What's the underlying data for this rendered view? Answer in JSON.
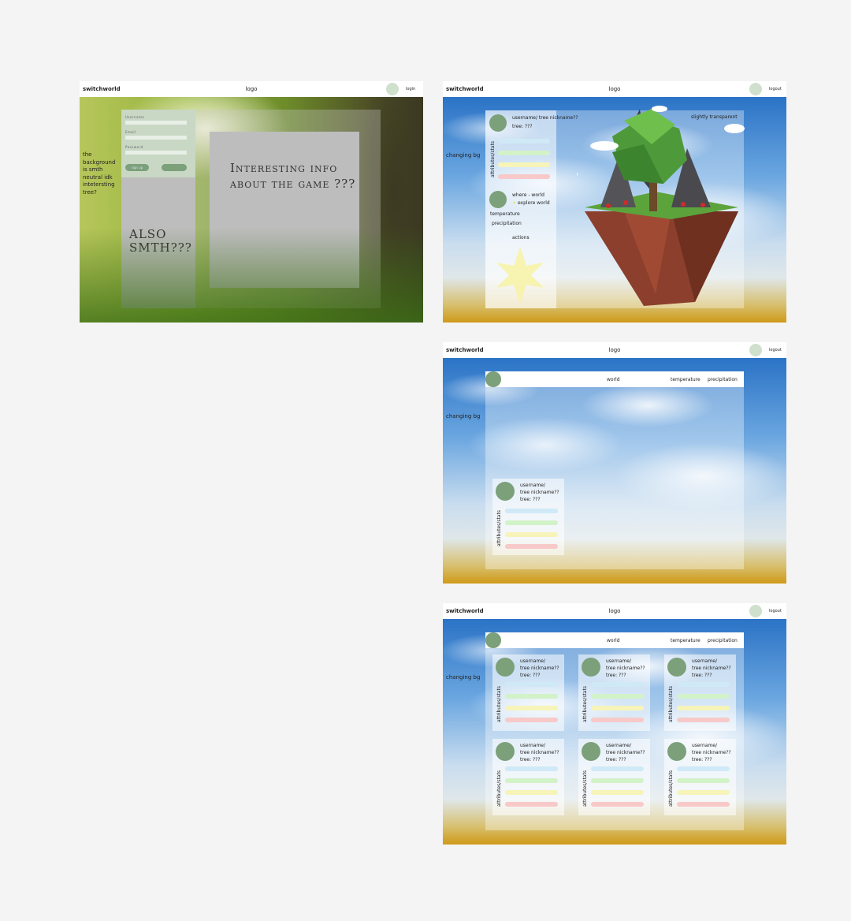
{
  "frames": {
    "login": {
      "brand": "switchworld",
      "logo": "logo",
      "action": "login",
      "side_note": "the background is smth neutral idk intetersting tree?",
      "form": {
        "username": "Username",
        "email": "Email",
        "password": "Password",
        "signup": "sign up"
      },
      "info": "Interesting info about the game ???",
      "also": "ALSO SMTH???"
    },
    "tree": {
      "brand": "switchworld",
      "logo": "logo",
      "action": "logout",
      "bg_note": "changing bg",
      "transparent_note": "slightly transparent",
      "profile_name": "username/ tree nickname??",
      "profile_tree": "tree: ???",
      "stats_label": "attributes/stats",
      "where": "where - world",
      "explore": "explore world",
      "temperature": "temperature",
      "precipitation": "precipitation",
      "actions": "actions"
    },
    "world1": {
      "brand": "switchworld",
      "logo": "logo",
      "action": "logout",
      "bg_note": "changing bg",
      "nav": {
        "world": "world",
        "temperature": "temperature",
        "precipitation": "precipitation"
      },
      "card": {
        "l1": "username/",
        "l2": "tree nickname??",
        "l3": "tree: ???",
        "stats": "attributes/stats"
      }
    },
    "world2": {
      "brand": "switchworld",
      "logo": "logo",
      "action": "logout",
      "bg_note": "changing bg",
      "nav": {
        "world": "world",
        "temperature": "temperature",
        "precipitation": "precipitation"
      },
      "card": {
        "l1": "username/",
        "l2": "tree nickname??",
        "l3": "tree: ???",
        "stats": "attributes/stats"
      }
    }
  },
  "colors": {
    "accent_green": "#7ca07a",
    "stat_blue": "#cfe9f7",
    "stat_green": "#d2f2c8",
    "stat_yellow": "#f6f4b8",
    "stat_red": "#f7c9c9"
  }
}
